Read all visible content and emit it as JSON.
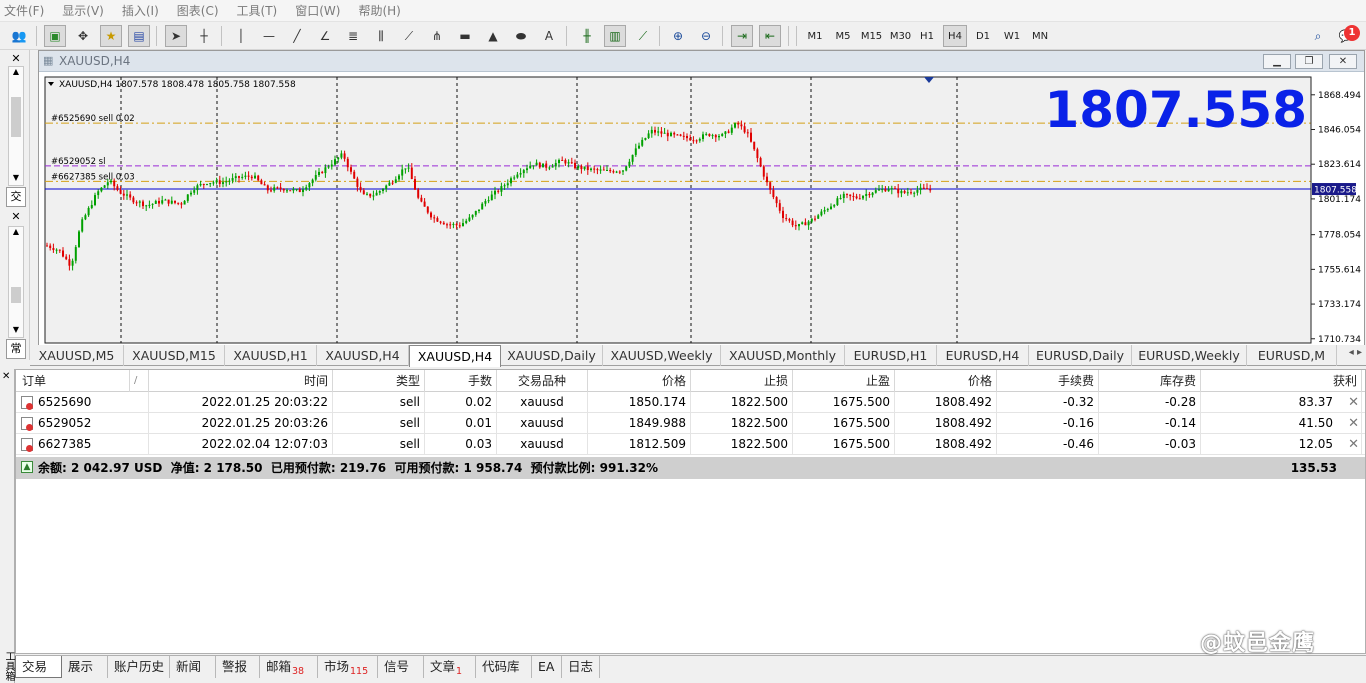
{
  "menu": [
    "文件(F)",
    "显示(V)",
    "插入(I)",
    "图表(C)",
    "工具(T)",
    "窗口(W)",
    "帮助(H)"
  ],
  "timeframes": [
    "M1",
    "M5",
    "M15",
    "M30",
    "H1",
    "H4",
    "D1",
    "W1",
    "MN"
  ],
  "active_timeframe": "H4",
  "notification_count": "1",
  "left_panel": {
    "tab_top": "交",
    "tab_bottom": "常"
  },
  "chart_window": {
    "title": "XAUUSD,H4",
    "info": "XAUUSD,H4  1807.578 1808.478 1805.758 1807.558",
    "big_price": "1807.558",
    "current_price_label": "1807.558",
    "price_axis": [
      "1868.494",
      "1846.054",
      "1823.614",
      "1801.174",
      "1778.054",
      "1755.614",
      "1733.174",
      "1710.734"
    ],
    "order_labels": [
      {
        "text": "#6525690 sell 0.02",
        "price": 1850.174
      },
      {
        "text": "#6529052 sl",
        "price": 1822.5
      },
      {
        "text": "#6627385 sell 0.03",
        "price": 1812.509
      }
    ],
    "colors": {
      "bull": "#00a000",
      "bear": "#e00000",
      "price_line": "#0000d0",
      "sell_line": "#d4a017",
      "sl_line": "#9a2bd6",
      "big_price": "#0a22e8"
    }
  },
  "chart_tabs": [
    "XAUUSD,M5",
    "XAUUSD,M15",
    "XAUUSD,H1",
    "XAUUSD,H4",
    "XAUUSD,H4",
    "XAUUSD,Daily",
    "XAUUSD,Weekly",
    "XAUUSD,Monthly",
    "EURUSD,H1",
    "EURUSD,H4",
    "EURUSD,Daily",
    "EURUSD,Weekly",
    "EURUSD,M"
  ],
  "active_chart_tab": 4,
  "terminal": {
    "side_label": "工具箱",
    "headers": [
      "订单",
      "/",
      "时间",
      "类型",
      "手数",
      "交易品种",
      "价格",
      "止损",
      "止盈",
      "价格",
      "手续费",
      "库存费",
      "获利"
    ],
    "rows": [
      {
        "order": "6525690",
        "time": "2022.01.25 20:03:22",
        "type": "sell",
        "lots": "0.02",
        "symbol": "xauusd",
        "price": "1850.174",
        "sl": "1822.500",
        "tp": "1675.500",
        "cur": "1808.492",
        "commission": "-0.32",
        "swap": "-0.28",
        "profit": "83.37"
      },
      {
        "order": "6529052",
        "time": "2022.01.25 20:03:26",
        "type": "sell",
        "lots": "0.01",
        "symbol": "xauusd",
        "price": "1849.988",
        "sl": "1822.500",
        "tp": "1675.500",
        "cur": "1808.492",
        "commission": "-0.16",
        "swap": "-0.14",
        "profit": "41.50"
      },
      {
        "order": "6627385",
        "time": "2022.02.04 12:07:03",
        "type": "sell",
        "lots": "0.03",
        "symbol": "xauusd",
        "price": "1812.509",
        "sl": "1822.500",
        "tp": "1675.500",
        "cur": "1808.492",
        "commission": "-0.46",
        "swap": "-0.03",
        "profit": "12.05"
      }
    ],
    "summary": "余额: 2 042.97 USD  净值: 2 178.50  已用预付款: 219.76  可用预付款: 1 958.74  预付款比例: 991.32%",
    "summary_profit": "135.53"
  },
  "bottom_tabs": [
    {
      "label": "交易",
      "badge": ""
    },
    {
      "label": "展示",
      "badge": ""
    },
    {
      "label": "账户历史",
      "badge": ""
    },
    {
      "label": "新闻",
      "badge": ""
    },
    {
      "label": "警报",
      "badge": ""
    },
    {
      "label": "邮箱",
      "badge": "38"
    },
    {
      "label": "市场",
      "badge": "115"
    },
    {
      "label": "信号",
      "badge": ""
    },
    {
      "label": "文章",
      "badge": "1"
    },
    {
      "label": "代码库",
      "badge": ""
    },
    {
      "label": "EA",
      "badge": ""
    },
    {
      "label": "日志",
      "badge": ""
    }
  ],
  "watermark": "@蚊邑金鹰"
}
